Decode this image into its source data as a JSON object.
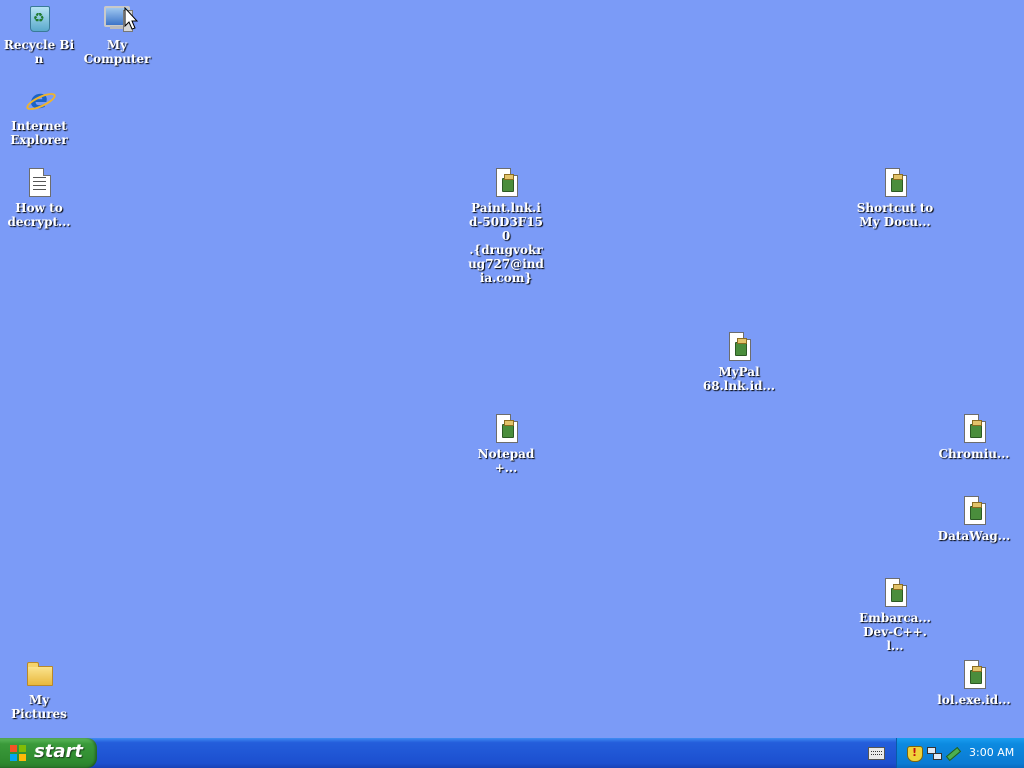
{
  "desktop": {
    "icons": [
      {
        "label": "Recycle Bin",
        "icon": "recycle-bin-icon"
      },
      {
        "label": "My\nComputer",
        "icon": "my-computer-icon"
      },
      {
        "label": "Internet\nExplorer",
        "icon": "internet-explorer-icon"
      },
      {
        "label": "How to\ndecrypt...",
        "icon": "text-document-icon"
      },
      {
        "label": "Paint.lnk.i\nd-50D3F150\n.{drugvokr\nug727@ind\nia.com}",
        "icon": "encrypted-file-icon"
      },
      {
        "label": "Shortcut to\nMy Docu...",
        "icon": "encrypted-file-icon"
      },
      {
        "label": "MyPal\n68.lnk.id...",
        "icon": "encrypted-file-icon"
      },
      {
        "label": "Notepad+...",
        "icon": "encrypted-file-icon"
      },
      {
        "label": "Chromiu...",
        "icon": "encrypted-file-icon"
      },
      {
        "label": "DataWag...",
        "icon": "encrypted-file-icon"
      },
      {
        "label": "Embarca...\nDev-C++.l...",
        "icon": "encrypted-file-icon"
      },
      {
        "label": "lol.exe.id...",
        "icon": "encrypted-file-icon"
      },
      {
        "label": "My\nPictures",
        "icon": "folder-icon"
      }
    ]
  },
  "taskbar": {
    "start_label": "start",
    "clock": "3:00 AM",
    "tray_icons": [
      "security-shield-icon",
      "network-icon",
      "pen-tool-icon"
    ]
  },
  "colors": {
    "desktop_bg": "#7b9bf7",
    "taskbar": "#245edb",
    "start_button": "#3a9a3a",
    "tray": "#0c8ae0"
  }
}
